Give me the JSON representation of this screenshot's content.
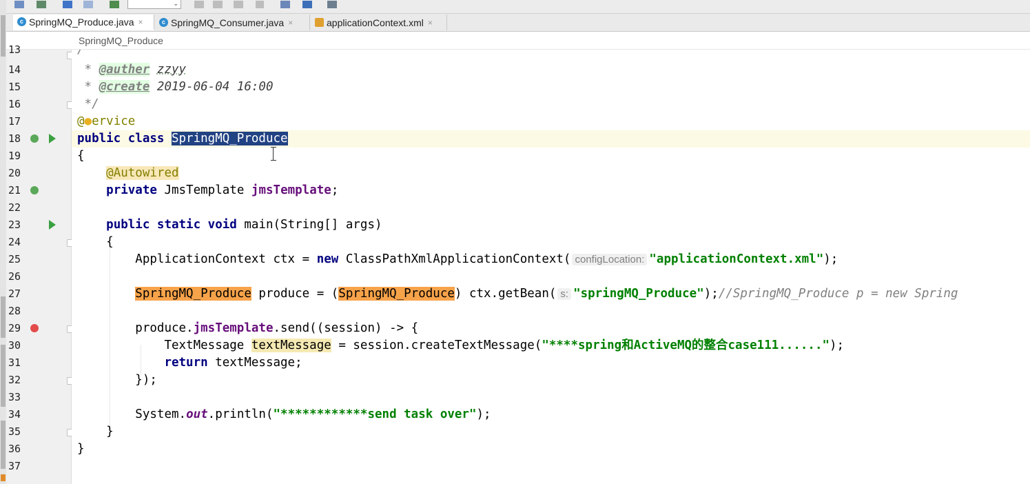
{
  "tabs": [
    {
      "label": "SpringMQ_Produce.java",
      "icon": "java-class-icon",
      "active": true
    },
    {
      "label": "SpringMQ_Consumer.java",
      "icon": "java-class-icon",
      "active": false
    },
    {
      "label": "applicationContext.xml",
      "icon": "xml-file-icon",
      "active": false
    }
  ],
  "tab_close_glyph": "×",
  "breadcrumb": "SpringMQ_Produce",
  "colors": {
    "selection": "#214283",
    "keyword": "#000080",
    "string": "#008000",
    "field": "#660e7a",
    "annotation": "#808000",
    "usage_highlight": "#f7a34a",
    "current_line": "#fcfae4"
  },
  "code": {
    "line_numbers": [
      "13",
      "14",
      "15",
      "16",
      "17",
      "18",
      "19",
      "20",
      "21",
      "22",
      "23",
      "24",
      "25",
      "26",
      "27",
      "28",
      "29",
      "30",
      "31",
      "32",
      "33",
      "34",
      "35",
      "36",
      "37"
    ],
    "l13": "/**",
    "l14_star": " * ",
    "l14_tag": "@auther",
    "l14_val": "zzyy",
    "l15_star": " * ",
    "l15_tag": "@create",
    "l15_val": "2019-06-04 16:00",
    "l16": " */",
    "l17_at": "@",
    "l17_rest": "ervice",
    "l18_kw": "public class",
    "l18_name": "SpringMQ_Produce",
    "l19": "{",
    "l20": "@Autowired",
    "l21_kw": "private",
    "l21_type": "JmsTemplate",
    "l21_field": "jmsTemplate",
    "l21_end": ";",
    "l23_kw": "public static void",
    "l23_rest": "main(String[] args)",
    "l24": "{",
    "l25_a": "ApplicationContext ctx = ",
    "l25_new": "new",
    "l25_b": "ClassPathXmlApplicationContext(",
    "l25_hint": "configLocation:",
    "l25_str": "\"applicationContext.xml\"",
    "l25_end": ");",
    "l27_type": "SpringMQ_Produce",
    "l27_a": " produce = (",
    "l27_cast": "SpringMQ_Produce",
    "l27_b": ") ctx.getBean(",
    "l27_hint": "s:",
    "l27_str": "\"springMQ_Produce\"",
    "l27_end": ");",
    "l27_cmt": "//SpringMQ_Produce p = new Spring",
    "l29_a": "produce.",
    "l29_field": "jmsTemplate",
    "l29_b": ".send((session) -> {",
    "l30_type": "TextMessage ",
    "l30_var": "textMessage",
    "l30_b": " = session.createTextMessage(",
    "l30_str": "\"****spring和ActiveMQ的整合case111......\"",
    "l30_end": ");",
    "l31_kw": "return",
    "l31_rest": " textMessage;",
    "l32": "});",
    "l34_a": "System.",
    "l34_out": "out",
    "l34_b": ".println(",
    "l34_str": "\"************send task over\"",
    "l34_end": ");",
    "l35": "}",
    "l36": "}"
  }
}
